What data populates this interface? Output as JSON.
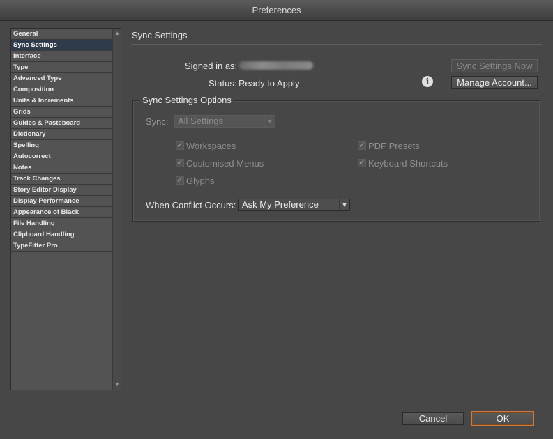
{
  "window": {
    "title": "Preferences"
  },
  "sidebar": {
    "items": [
      {
        "label": "General"
      },
      {
        "label": "Sync Settings",
        "selected": true
      },
      {
        "label": "Interface"
      },
      {
        "label": "Type"
      },
      {
        "label": "Advanced Type"
      },
      {
        "label": "Composition"
      },
      {
        "label": "Units & Increments"
      },
      {
        "label": "Grids"
      },
      {
        "label": "Guides & Pasteboard"
      },
      {
        "label": "Dictionary"
      },
      {
        "label": "Spelling"
      },
      {
        "label": "Autocorrect"
      },
      {
        "label": "Notes"
      },
      {
        "label": "Track Changes"
      },
      {
        "label": "Story Editor Display"
      },
      {
        "label": "Display Performance"
      },
      {
        "label": "Appearance of Black"
      },
      {
        "label": "File Handling"
      },
      {
        "label": "Clipboard Handling"
      },
      {
        "label": "TypeFitter Pro"
      }
    ],
    "scroll_up_icon": "triangle-up",
    "scroll_down_icon": "triangle-down"
  },
  "main": {
    "section_title": "Sync Settings",
    "signed_in_label": "Signed in as:",
    "status_label": "Status:",
    "status_value": "Ready to Apply",
    "sync_now_button": "Sync Settings Now",
    "manage_account_button": "Manage Account...",
    "info_icon": "i",
    "options": {
      "group_title": "Sync Settings Options",
      "sync_label": "Sync:",
      "sync_select_value": "All Settings",
      "checkboxes_left": [
        {
          "label": "Workspaces",
          "checked": true
        },
        {
          "label": "Customised Menus",
          "checked": true
        },
        {
          "label": "Glyphs",
          "checked": true
        }
      ],
      "checkboxes_right": [
        {
          "label": "PDF Presets",
          "checked": true
        },
        {
          "label": "Keyboard Shortcuts",
          "checked": true
        }
      ],
      "conflict_label": "When Conflict Occurs:",
      "conflict_select_value": "Ask My Preference"
    }
  },
  "footer": {
    "cancel_button": "Cancel",
    "ok_button": "OK"
  },
  "colors": {
    "background": "#474747",
    "selection": "#2f3a4a",
    "ok_border": "#d0793a"
  }
}
